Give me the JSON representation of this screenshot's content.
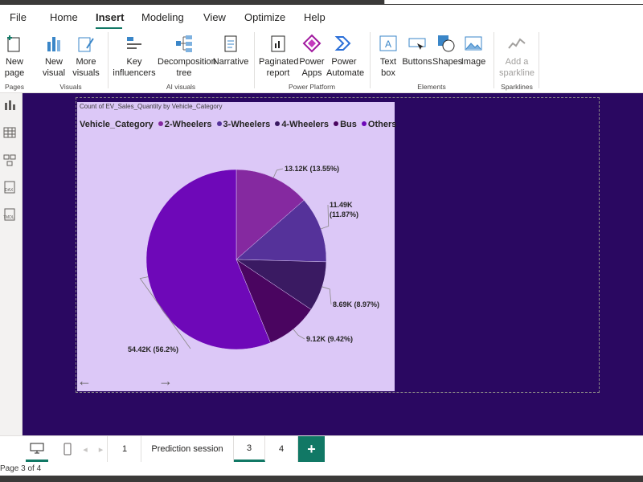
{
  "menu": [
    {
      "label": "File"
    },
    {
      "label": "Home"
    },
    {
      "label": "Insert"
    },
    {
      "label": "Modeling"
    },
    {
      "label": "View"
    },
    {
      "label": "Optimize"
    },
    {
      "label": "Help"
    }
  ],
  "ribbon": {
    "new_page": "New page",
    "new_visual": "New visual",
    "more_visuals": "More visuals",
    "key_influencers": "Key influencers",
    "decomposition_tree": "Decomposition tree",
    "narrative": "Narrative",
    "paginated_report": "Paginated report",
    "power_apps": "Power Apps",
    "power_automate": "Power Automate",
    "text_box": "Text box",
    "buttons": "Buttons",
    "shapes": "Shapes",
    "image": "Image",
    "add_sparkline": "Add a sparkline",
    "groups": {
      "pages": "Pages",
      "visuals": "Visuals",
      "ai_visuals": "AI visuals",
      "power_platform": "Power Platform",
      "elements": "Elements",
      "sparklines": "Sparklines"
    }
  },
  "chart_data": {
    "type": "pie",
    "title": "Count of EV_Sales_Quantity by Vehicle_Category",
    "legend_title": "Vehicle_Category",
    "legend_position": "top-left",
    "slices": [
      {
        "name": "2-Wheelers",
        "value": 13.12,
        "label": "13.12K (13.55%)",
        "color": "#8529a0"
      },
      {
        "name": "3-Wheelers",
        "value": 11.49,
        "label": "11.49K (11.87%)",
        "color": "#55329a"
      },
      {
        "name": "4-Wheelers",
        "value": 8.69,
        "label": "8.69K (8.97%)",
        "color": "#3a1a62"
      },
      {
        "name": "Bus",
        "value": 9.12,
        "label": "9.12K (9.42%)",
        "color": "#4a0560"
      },
      {
        "name": "Others",
        "value": 54.42,
        "label": "54.42K (56.2%)",
        "color": "#6e08b8"
      }
    ]
  },
  "tabs": [
    {
      "label": "1"
    },
    {
      "label": "Prediction session"
    },
    {
      "label": "3"
    },
    {
      "label": "4"
    }
  ],
  "add_tab": "+",
  "page_info": "Page 3 of 4"
}
